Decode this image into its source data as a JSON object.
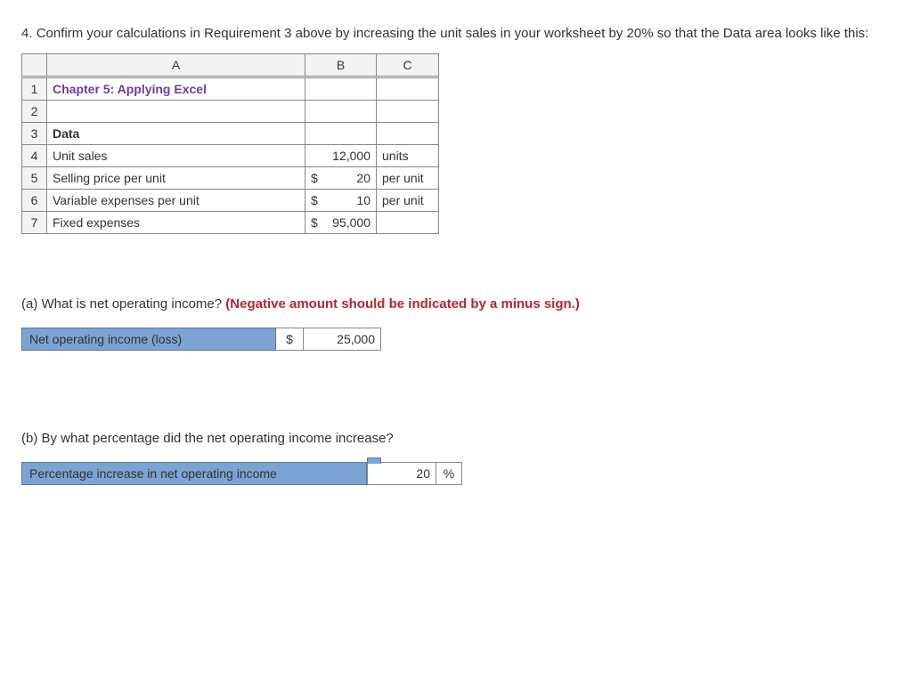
{
  "question": {
    "prefix": "4. ",
    "text": "Confirm your calculations in Requirement 3 above by increasing the unit sales in your worksheet by 20% so that the Data area looks like this:"
  },
  "sheet": {
    "cols": [
      "A",
      "B",
      "C"
    ],
    "rows": [
      {
        "n": "1",
        "a_class": "chapter-title",
        "a": "Chapter 5: Applying Excel",
        "b": "",
        "c": ""
      },
      {
        "n": "2",
        "a": "",
        "b": "",
        "c": ""
      },
      {
        "n": "3",
        "a_class": "bold",
        "a": "Data",
        "b": "",
        "c": ""
      },
      {
        "n": "4",
        "a": "Unit sales",
        "b_align": "right",
        "b": "12,000",
        "c": "units"
      },
      {
        "n": "5",
        "a": "Selling price per unit",
        "b_money": true,
        "b": "20",
        "c": "per unit"
      },
      {
        "n": "6",
        "a": "Variable expenses per unit",
        "b_money": true,
        "b": "10",
        "c": "per unit"
      },
      {
        "n": "7",
        "a": "Fixed expenses",
        "b_money": true,
        "b": "95,000",
        "c": ""
      }
    ]
  },
  "part_a": {
    "prompt": "(a) What is net operating income? ",
    "warn": "(Negative amount should be indicated by a minus sign.)",
    "label": "Net operating income (loss)",
    "currency": "$",
    "value": "25,000"
  },
  "part_b": {
    "prompt": "(b) By what percentage did the net operating income increase?",
    "label": "Percentage increase in net operating income",
    "value": "20",
    "unit": "%"
  }
}
